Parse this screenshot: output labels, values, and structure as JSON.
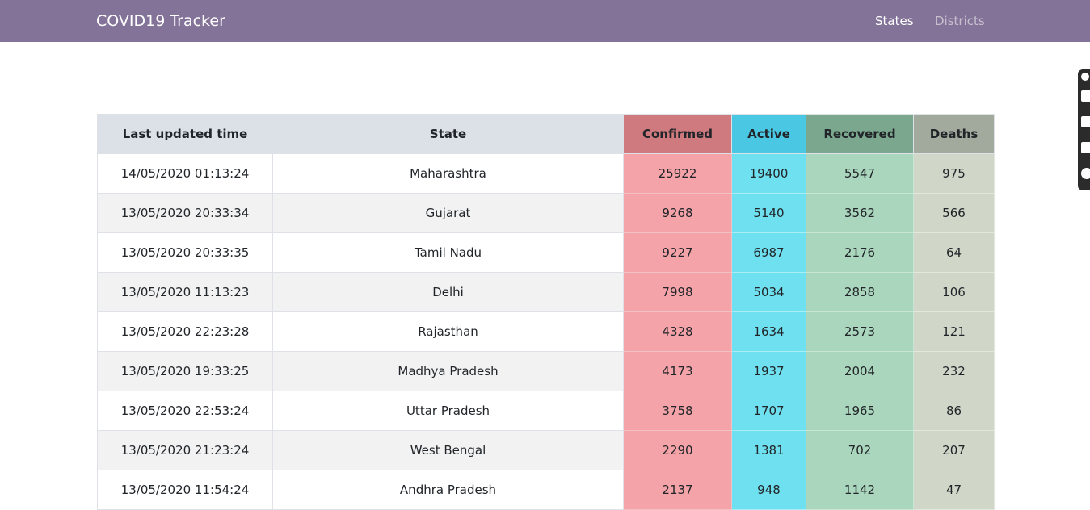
{
  "app": {
    "brand": "COVID19 Tracker",
    "nav": [
      {
        "label": "States",
        "active": true
      },
      {
        "label": "Districts",
        "active": false
      }
    ]
  },
  "colors": {
    "navbar": "#837398",
    "confirmed_header": "#cf7a7f",
    "active_header": "#4ac8e3",
    "recovered_header": "#7ba78e",
    "deaths_header": "#a2a99d"
  },
  "table": {
    "headers": [
      "Last updated time",
      "State",
      "Confirmed",
      "Active",
      "Recovered",
      "Deaths"
    ],
    "rows": [
      {
        "time": "14/05/2020 01:13:24",
        "state": "Maharashtra",
        "confirmed": "25922",
        "active": "19400",
        "recovered": "5547",
        "deaths": "975"
      },
      {
        "time": "13/05/2020 20:33:34",
        "state": "Gujarat",
        "confirmed": "9268",
        "active": "5140",
        "recovered": "3562",
        "deaths": "566"
      },
      {
        "time": "13/05/2020 20:33:35",
        "state": "Tamil Nadu",
        "confirmed": "9227",
        "active": "6987",
        "recovered": "2176",
        "deaths": "64"
      },
      {
        "time": "13/05/2020 11:13:23",
        "state": "Delhi",
        "confirmed": "7998",
        "active": "5034",
        "recovered": "2858",
        "deaths": "106"
      },
      {
        "time": "13/05/2020 22:23:28",
        "state": "Rajasthan",
        "confirmed": "4328",
        "active": "1634",
        "recovered": "2573",
        "deaths": "121"
      },
      {
        "time": "13/05/2020 19:33:25",
        "state": "Madhya Pradesh",
        "confirmed": "4173",
        "active": "1937",
        "recovered": "2004",
        "deaths": "232"
      },
      {
        "time": "13/05/2020 22:53:24",
        "state": "Uttar Pradesh",
        "confirmed": "3758",
        "active": "1707",
        "recovered": "1965",
        "deaths": "86"
      },
      {
        "time": "13/05/2020 21:23:24",
        "state": "West Bengal",
        "confirmed": "2290",
        "active": "1381",
        "recovered": "702",
        "deaths": "207"
      },
      {
        "time": "13/05/2020 11:54:24",
        "state": "Andhra Pradesh",
        "confirmed": "2137",
        "active": "948",
        "recovered": "1142",
        "deaths": "47"
      }
    ]
  },
  "side_widget": {
    "icons": [
      "pin-icon",
      "window-icon",
      "square-icon",
      "copy-icon",
      "gear-icon"
    ]
  }
}
